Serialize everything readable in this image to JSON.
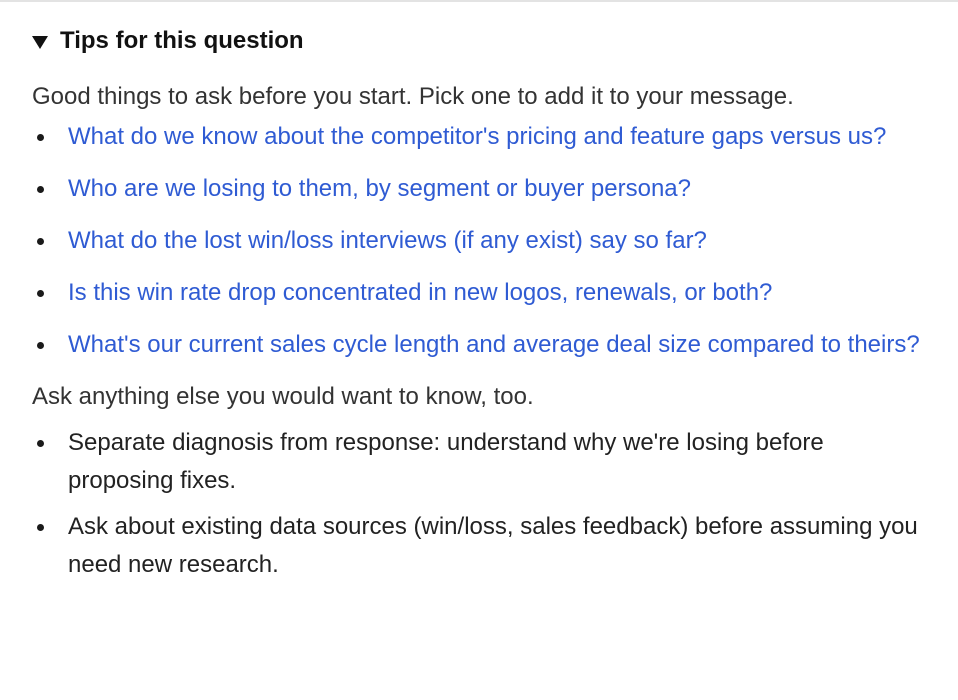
{
  "tips": {
    "title": "Tips for this question",
    "intro": "Good things to ask before you start. Pick one to add it to your message.",
    "suggestions": [
      "What do we know about the competitor's pricing and feature gaps versus us?",
      "Who are we losing to them, by segment or buyer persona?",
      "What do the lost win/loss interviews (if any exist) say so far?",
      "Is this win rate drop concentrated in new logos, renewals, or both?",
      "What's our current sales cycle length and average deal size compared to theirs?"
    ],
    "outro": "Ask anything else you would want to know, too.",
    "advice": [
      "Separate diagnosis from response: understand why we're losing before proposing fixes.",
      "Ask about existing data sources (win/loss, sales feedback) before assuming you need new research."
    ]
  },
  "colors": {
    "link": "#2f5bd3",
    "text": "#333333"
  }
}
